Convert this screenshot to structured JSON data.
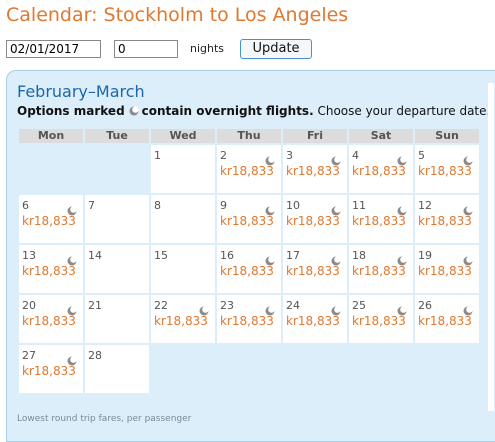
{
  "header": {
    "title": "Calendar: Stockholm to Los Angeles"
  },
  "controls": {
    "date_value": "02/01/2017",
    "nights_value": "0",
    "nights_label": "nights",
    "update_label": "Update"
  },
  "calendar": {
    "month_title": "February–March",
    "legend_prefix": "Options marked",
    "legend_bold_suffix": "contain overnight flights.",
    "legend_tail": " Choose your departure date.",
    "overnight_icon": "moon-icon",
    "weekdays": [
      "Mon",
      "Tue",
      "Wed",
      "Thu",
      "Fri",
      "Sat",
      "Sun"
    ],
    "days": [
      {
        "day": "1",
        "price": "",
        "overnight": false
      },
      {
        "day": "2",
        "price": "kr18,833",
        "overnight": true
      },
      {
        "day": "3",
        "price": "kr18,833",
        "overnight": true
      },
      {
        "day": "4",
        "price": "kr18,833",
        "overnight": true
      },
      {
        "day": "5",
        "price": "kr18,833",
        "overnight": true
      },
      {
        "day": "6",
        "price": "kr18,833",
        "overnight": true
      },
      {
        "day": "7",
        "price": "",
        "overnight": false
      },
      {
        "day": "8",
        "price": "",
        "overnight": false
      },
      {
        "day": "9",
        "price": "kr18,833",
        "overnight": true
      },
      {
        "day": "10",
        "price": "kr18,833",
        "overnight": true
      },
      {
        "day": "11",
        "price": "kr18,833",
        "overnight": true
      },
      {
        "day": "12",
        "price": "kr18,833",
        "overnight": true
      },
      {
        "day": "13",
        "price": "kr18,833",
        "overnight": true
      },
      {
        "day": "14",
        "price": "",
        "overnight": false
      },
      {
        "day": "15",
        "price": "",
        "overnight": false
      },
      {
        "day": "16",
        "price": "kr18,833",
        "overnight": true
      },
      {
        "day": "17",
        "price": "kr18,833",
        "overnight": true
      },
      {
        "day": "18",
        "price": "kr18,833",
        "overnight": true
      },
      {
        "day": "19",
        "price": "kr18,833",
        "overnight": true
      },
      {
        "day": "20",
        "price": "kr18,833",
        "overnight": true
      },
      {
        "day": "21",
        "price": "",
        "overnight": false
      },
      {
        "day": "22",
        "price": "kr18,833",
        "overnight": true
      },
      {
        "day": "23",
        "price": "kr18,833",
        "overnight": true
      },
      {
        "day": "24",
        "price": "kr18,833",
        "overnight": true
      },
      {
        "day": "25",
        "price": "kr18,833",
        "overnight": true
      },
      {
        "day": "26",
        "price": "kr18,833",
        "overnight": true
      },
      {
        "day": "27",
        "price": "kr18,833",
        "overnight": true
      },
      {
        "day": "28",
        "price": "",
        "overnight": false
      }
    ],
    "footnote": "Lowest round trip fares, per passenger"
  },
  "colors": {
    "accent_orange": "#e0782f",
    "title_blue": "#1d67a8",
    "panel_bg": "#dbeefa"
  }
}
